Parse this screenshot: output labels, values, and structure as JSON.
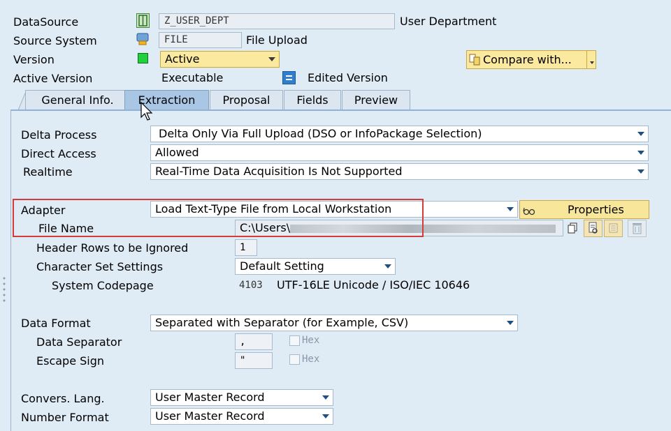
{
  "header": {
    "datasource_label": "DataSource",
    "datasource_value": "Z_USER_DEPT",
    "datasource_desc": "User Department",
    "source_system_label": "Source System",
    "source_system_value": "FILE",
    "source_system_desc": "File Upload",
    "version_label": "Version",
    "version_value": "Active",
    "active_version_label": "Active Version",
    "active_version_value": "Executable",
    "edited_version_label": "Edited Version",
    "compare_button": "Compare with..."
  },
  "tabs": [
    {
      "label": "General Info."
    },
    {
      "label": "Extraction"
    },
    {
      "label": "Proposal"
    },
    {
      "label": "Fields"
    },
    {
      "label": "Preview"
    }
  ],
  "extraction": {
    "delta_process_label": "Delta Process",
    "delta_process_value": "Delta Only Via Full Upload (DSO or InfoPackage Selection)",
    "direct_access_label": "Direct Access",
    "direct_access_value": "Allowed",
    "realtime_label": "Realtime",
    "realtime_value": "Real-Time Data Acquisition Is Not Supported",
    "adapter_label": "Adapter",
    "adapter_value": "Load Text-Type File from Local Workstation",
    "properties_button": "Properties",
    "file_name_label": "File Name",
    "file_name_value": "C:\\Users\\",
    "header_rows_label": "Header Rows to be Ignored",
    "header_rows_value": "1",
    "charset_label": "Character Set Settings",
    "charset_value": "Default Setting",
    "codepage_label": "System Codepage",
    "codepage_number": "4103",
    "codepage_desc": "UTF-16LE Unicode / ISO/IEC 10646",
    "data_format_label": "Data Format",
    "data_format_value": "Separated with Separator (for Example, CSV)",
    "data_separator_label": "Data Separator",
    "data_separator_value": ",",
    "escape_sign_label": "Escape Sign",
    "escape_sign_value": "\"",
    "hex_label": "Hex",
    "convers_lang_label": "Convers. Lang.",
    "convers_lang_value": "User Master Record",
    "number_format_label": "Number Format",
    "number_format_value": "User Master Record"
  },
  "colors": {
    "accent": "#a9c6e4",
    "highlight": "#fbe9a0",
    "button": "#f8e79a",
    "status_active": "#1fd13a",
    "redbox": "#d43b3b"
  }
}
